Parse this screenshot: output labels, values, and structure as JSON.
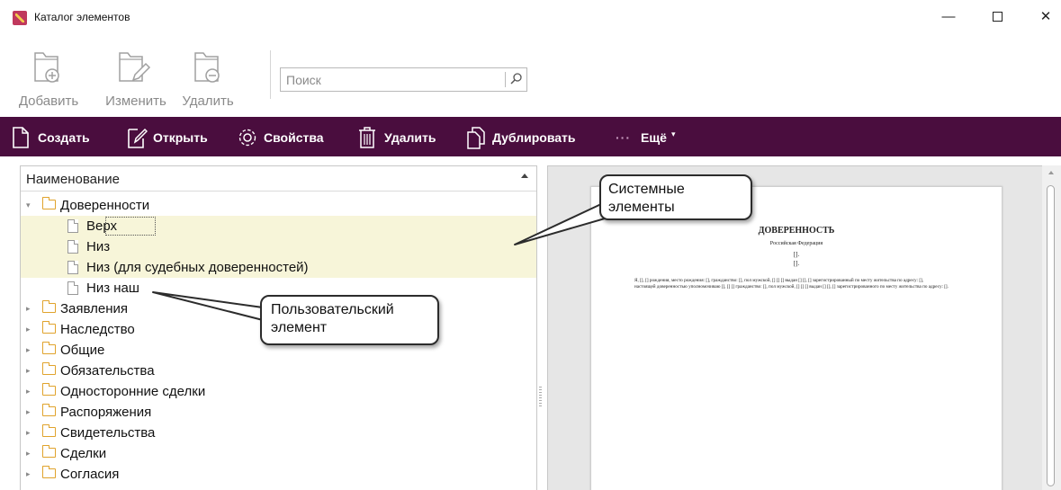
{
  "window": {
    "title": "Каталог элементов",
    "minimize": "—",
    "close": "✕"
  },
  "ribbon": {
    "add_label": "Добавить",
    "edit_label": "Изменить",
    "delete_label": "Удалить",
    "search_placeholder": "Поиск"
  },
  "toolbar": {
    "create": "Создать",
    "open": "Открыть",
    "properties": "Свойства",
    "delete": "Удалить",
    "duplicate": "Дублировать",
    "more_dots": "···",
    "more": "Ещё",
    "more_caret": "▾"
  },
  "tree": {
    "header": "Наименование",
    "expanded_arrow": "▾",
    "collapsed_arrow": "▸",
    "items": [
      {
        "label": "Доверенности"
      },
      {
        "label": "Верх"
      },
      {
        "label": "Низ"
      },
      {
        "label": "Низ (для судебных доверенностей)"
      },
      {
        "label": "Низ наш"
      },
      {
        "label": "Заявления"
      },
      {
        "label": "Наследство"
      },
      {
        "label": "Общие"
      },
      {
        "label": "Обязательства"
      },
      {
        "label": "Односторонние сделки"
      },
      {
        "label": "Распоряжения"
      },
      {
        "label": "Свидетельства"
      },
      {
        "label": "Сделки"
      },
      {
        "label": "Согласия"
      }
    ]
  },
  "preview": {
    "title": "ДОВЕРЕННОСТЬ",
    "subtitle": "Российская Федерация",
    "bracket1": "[].",
    "bracket2": "[].",
    "para1": "Я, [], [] рождения, место рождения: [], гражданство: [], пол мужской, [] [] [] выдан [] [], [] зарегистрированный по месту жительства по адресу: [],",
    "para2": "настоящей доверенностью уполномочиваю [], [] [] гражданство: [], пол мужской, [] [] [] выдан [] [], [] зарегистрированного по месту жительства по адресу: []."
  },
  "callouts": {
    "system": "Системные элементы",
    "user": "Пользовательский элемент"
  },
  "colors": {
    "toolbar_bg": "#4a0d3e",
    "system_row_bg": "#f7f5d9",
    "folder": "#e0a32c"
  }
}
